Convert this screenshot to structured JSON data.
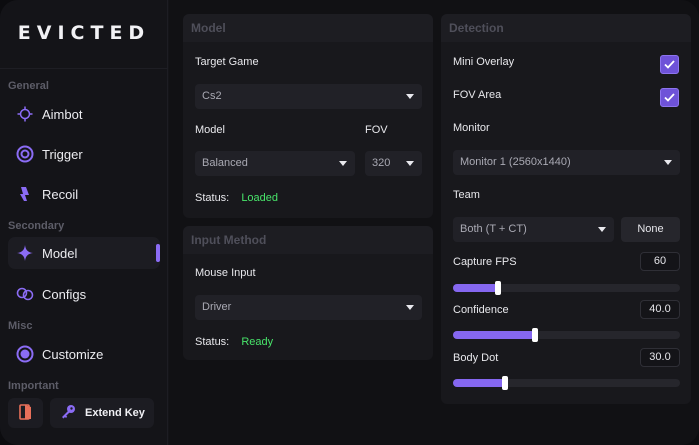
{
  "app": {
    "title": "EVICTED"
  },
  "sidebar": {
    "sections": {
      "general": "General",
      "secondary": "Secondary",
      "misc": "Misc",
      "important": "Important"
    },
    "items": [
      {
        "label": "Aimbot",
        "icon": "crosshair-icon"
      },
      {
        "label": "Trigger",
        "icon": "target-ring-icon"
      },
      {
        "label": "Recoil",
        "icon": "recoil-icon"
      },
      {
        "label": "Model",
        "icon": "sparkle-icon",
        "active": true
      },
      {
        "label": "Configs",
        "icon": "link-icon"
      },
      {
        "label": "Customize",
        "icon": "palette-icon"
      }
    ],
    "exit_icon": "exit-door-icon",
    "extend_key_label": "Extend Key"
  },
  "model_panel": {
    "title": "Model",
    "target_game_label": "Target Game",
    "target_game_value": "Cs2",
    "model_label": "Model",
    "model_value": "Balanced",
    "fov_label": "FOV",
    "fov_value": "320",
    "status_label": "Status:",
    "status_value": "Loaded"
  },
  "input_panel": {
    "title": "Input Method",
    "mouse_input_label": "Mouse Input",
    "mouse_input_value": "Driver",
    "status_label": "Status:",
    "status_value": "Ready"
  },
  "detection_panel": {
    "title": "Detection",
    "mini_overlay_label": "Mini Overlay",
    "mini_overlay_checked": true,
    "fov_area_label": "FOV Area",
    "fov_area_checked": true,
    "monitor_label": "Monitor",
    "monitor_value": "Monitor 1 (2560x1440)",
    "team_label": "Team",
    "team_value": "Both (T + CT)",
    "team_none_label": "None",
    "capture_fps_label": "Capture FPS",
    "capture_fps_value": "60",
    "capture_fps_level": 0.2,
    "confidence_label": "Confidence",
    "confidence_value": "40.0",
    "confidence_level": 0.36,
    "body_dot_label": "Body Dot",
    "body_dot_value": "30.0",
    "body_dot_level": 0.23
  },
  "colors": {
    "accent": "#8567f0",
    "status_ok": "#48e46a",
    "background": "#111114"
  }
}
